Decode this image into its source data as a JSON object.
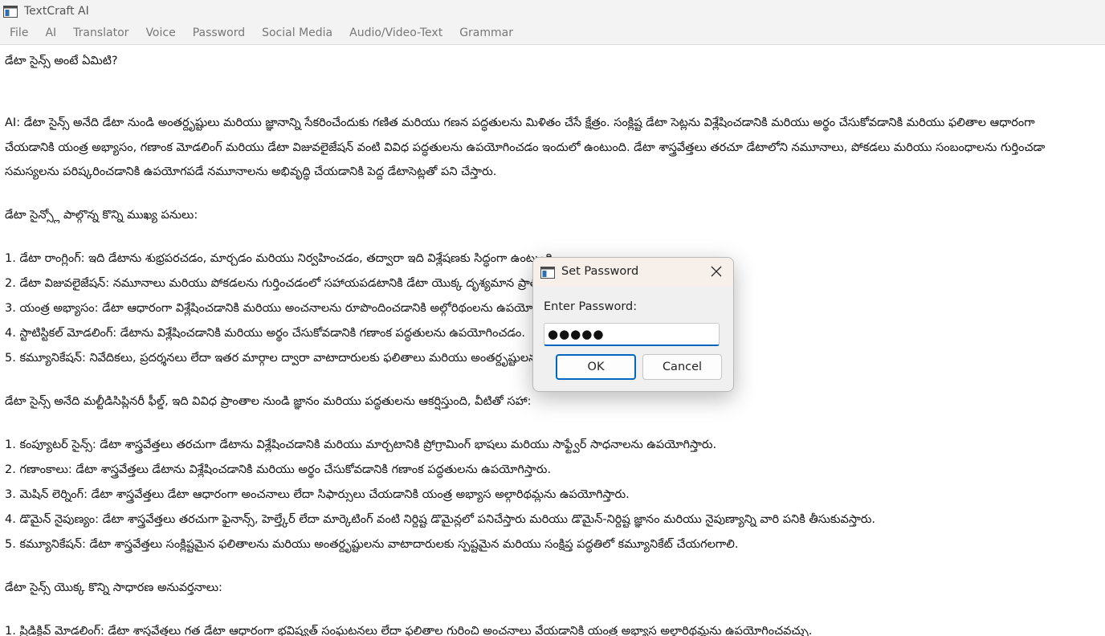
{
  "window": {
    "title": "TextCraft AI",
    "icon": "app-window-icon"
  },
  "menu": [
    "File",
    "AI",
    "Translator",
    "Voice",
    "Password",
    "Social Media",
    "Audio/Video-Text",
    "Grammar"
  ],
  "document": {
    "lines": [
      "డేటా సైన్స్ అంటే ఏమిటి?",
      "",
      "",
      "AI: డేటా సైన్స్ అనేది డేటా నుండి అంతర్దృష్టులు మరియు జ్ఞానాన్ని సేకరించేందుకు గణిత మరియు గణన పద్ధతులను మిళితం చేసే క్షేత్రం. సంక్లిష్ట డేటా సెట్లను విశ్లేషించడానికి మరియు అర్థం చేసుకోవడానికి మరియు ఫలితాల ఆధారంగా",
      "చేయడానికి యంత్ర అభ్యాసం, గణాంక మోడలింగ్ మరియు డేటా విజువలైజేషన్ వంటి వివిధ పద్ధతులను ఉపయోగించడం ఇందులో ఉంటుంది. డేటా శాస్త్రవేత్తలు తరచూ డేటాలోని నమూనాలు, పోకడలు మరియు సంబంధాలను గుర్తించడా",
      "సమస్యలను పరిష్కరించడానికి ఉపయోగపడే నమూనాలను అభివృద్ధి చేయడానికి పెద్ద డేటాసెట్లతో పని చేస్తారు.",
      "",
      "డేటా సైన్స్లో పాల్గొన్న కొన్ని ముఖ్య పనులు:",
      "",
      "1. డేటా రాంగ్లింగ్: ఇది డేటాను శుభ్రపరచడం, మార్చడం మరియు నిర్వహించడం, తద్వారా ఇది విశ్లేషణకు సిద్ధంగా ఉంటుంది.",
      "2. డేటా విజువలైజేషన్: నమూనాలు మరియు పోకడలను గుర్తించడంలో సహాయపడటానికి డేటా యొక్క దృశ్యమాన ప్రాతినిధ్యాలను సృష్టించడం ఇందులో ఉంటుంది.",
      "3. యంత్ర అభ్యాసం: డేటా ఆధారంగా విశ్లేషించడానికి మరియు అంచనాలను రూపొందించడానికి అల్గోరిథంలను ఉపయోగించడం.",
      "4. స్టాటిస్టికల్ మోడలింగ్: డేటాను విశ్లేషించడానికి మరియు అర్థం చేసుకోవడానికి గణాంక పద్ధతులను ఉపయోగించడం.",
      "5. కమ్యూనికేషన్: నివేదికలు, ప్రదర్శనలు లేదా ఇతర మార్గాల ద్వారా వాటాదారులకు ఫలితాలు మరియు అంతర్దృష్టులను కమ్యూనికేట్ చేయడం.",
      "",
      "డేటా సైన్స్ అనేది మల్టీడిసిప్లినరీ ఫీల్డ్, ఇది వివిధ ప్రాంతాల నుండి జ్ఞానం మరియు పద్ధతులను ఆకర్షిస్తుంది, వీటితో సహా:",
      "",
      "1. కంప్యూటర్ సైన్స్: డేటా శాస్త్రవేత్తలు తరచుగా డేటాను విశ్లేషించడానికి మరియు మార్చటానికి ప్రోగ్రామింగ్ భాషలు మరియు సాఫ్ట్వేర్ సాధనాలను ఉపయోగిస్తారు.",
      "2. గణాంకాలు: డేటా శాస్త్రవేత్తలు డేటాను విశ్లేషించడానికి మరియు అర్థం చేసుకోవడానికి గణాంక పద్ధతులను ఉపయోగిస్తారు.",
      "3. మెషిన్ లెర్నింగ్: డేటా శాస్త్రవేత్తలు డేటా ఆధారంగా అంచనాలు లేదా సిఫార్సులు చేయడానికి యంత్ర అభ్యాస అల్గారిథమ్లను ఉపయోగిస్తారు.",
      "4. డొమైన్ నైపుణ్యం: డేటా శాస్త్రవేత్తలు తరచుగా ఫైనాన్స్, హెల్త్కేర్ లేదా మార్కెటింగ్ వంటి నిర్దిష్ట డొమైన్లలో పనిచేస్తారు మరియు డొమైన్-నిర్దిష్ట జ్ఞానం మరియు నైపుణ్యాన్ని వారి పనికి తీసుకువస్తారు.",
      "5. కమ్యూనికేషన్: డేటా శాస్త్రవేత్తలు సంక్లిష్టమైన ఫలితాలను మరియు అంతర్దృష్టులను వాటాదారులకు స్పష్టమైన మరియు సంక్షిప్త పద్ధతిలో కమ్యూనికేట్ చేయగలగాలి.",
      "",
      "డేటా సైన్స్ యొక్క కొన్ని సాధారణ అనువర్తనాలు:",
      "",
      "1. ప్రిడిక్టివ్ మోడలింగ్: డేటా శాస్త్రవేత్తలు గత డేటా ఆధారంగా భవిష్యత్ సంఘటనలు లేదా ఫలితాల గురించి అంచనాలు వేయడానికి యంత్ర అభ్యాస అల్గారిథమ్లను ఉపయోగించవచ్చు."
    ]
  },
  "dialog": {
    "title": "Set Password",
    "icon": "app-window-icon",
    "close_icon": "close-icon",
    "label": "Enter Password:",
    "password_value": "●●●●●",
    "ok_label": "OK",
    "cancel_label": "Cancel",
    "accent_color": "#0067c0"
  }
}
